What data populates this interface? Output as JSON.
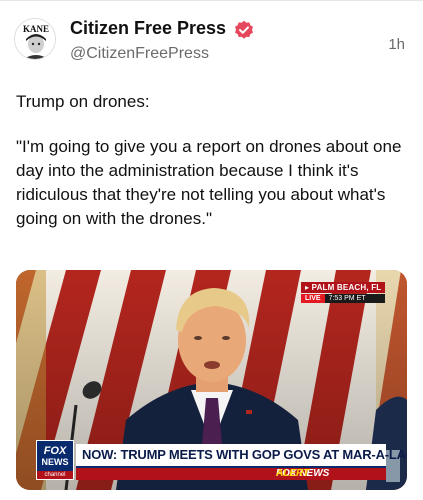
{
  "author": {
    "name": "Citizen Free Press",
    "handle": "@CitizenFreePress",
    "avatar_text": "KANE",
    "verified_color": "#e5485c"
  },
  "timestamp": "1h",
  "post": {
    "lines": [
      "Trump on drones:",
      "\"I'm going to give you a report on drones about one day into the administration because I think it's ridiculous that they're not telling you about what's going on with the drones.\""
    ]
  },
  "media": {
    "location": "PALM BEACH, FL",
    "live_label": "LIVE",
    "time": "7:53 PM ET",
    "logo_line1": "FOX",
    "logo_line2": "NEWS",
    "logo_line3": "channel",
    "headline": "NOW: TRUMP MEETS WITH GOP GOVS AT MAR-A-LAGO",
    "alert_brand": "FOX NEWS",
    "alert_word": "ALERT"
  }
}
